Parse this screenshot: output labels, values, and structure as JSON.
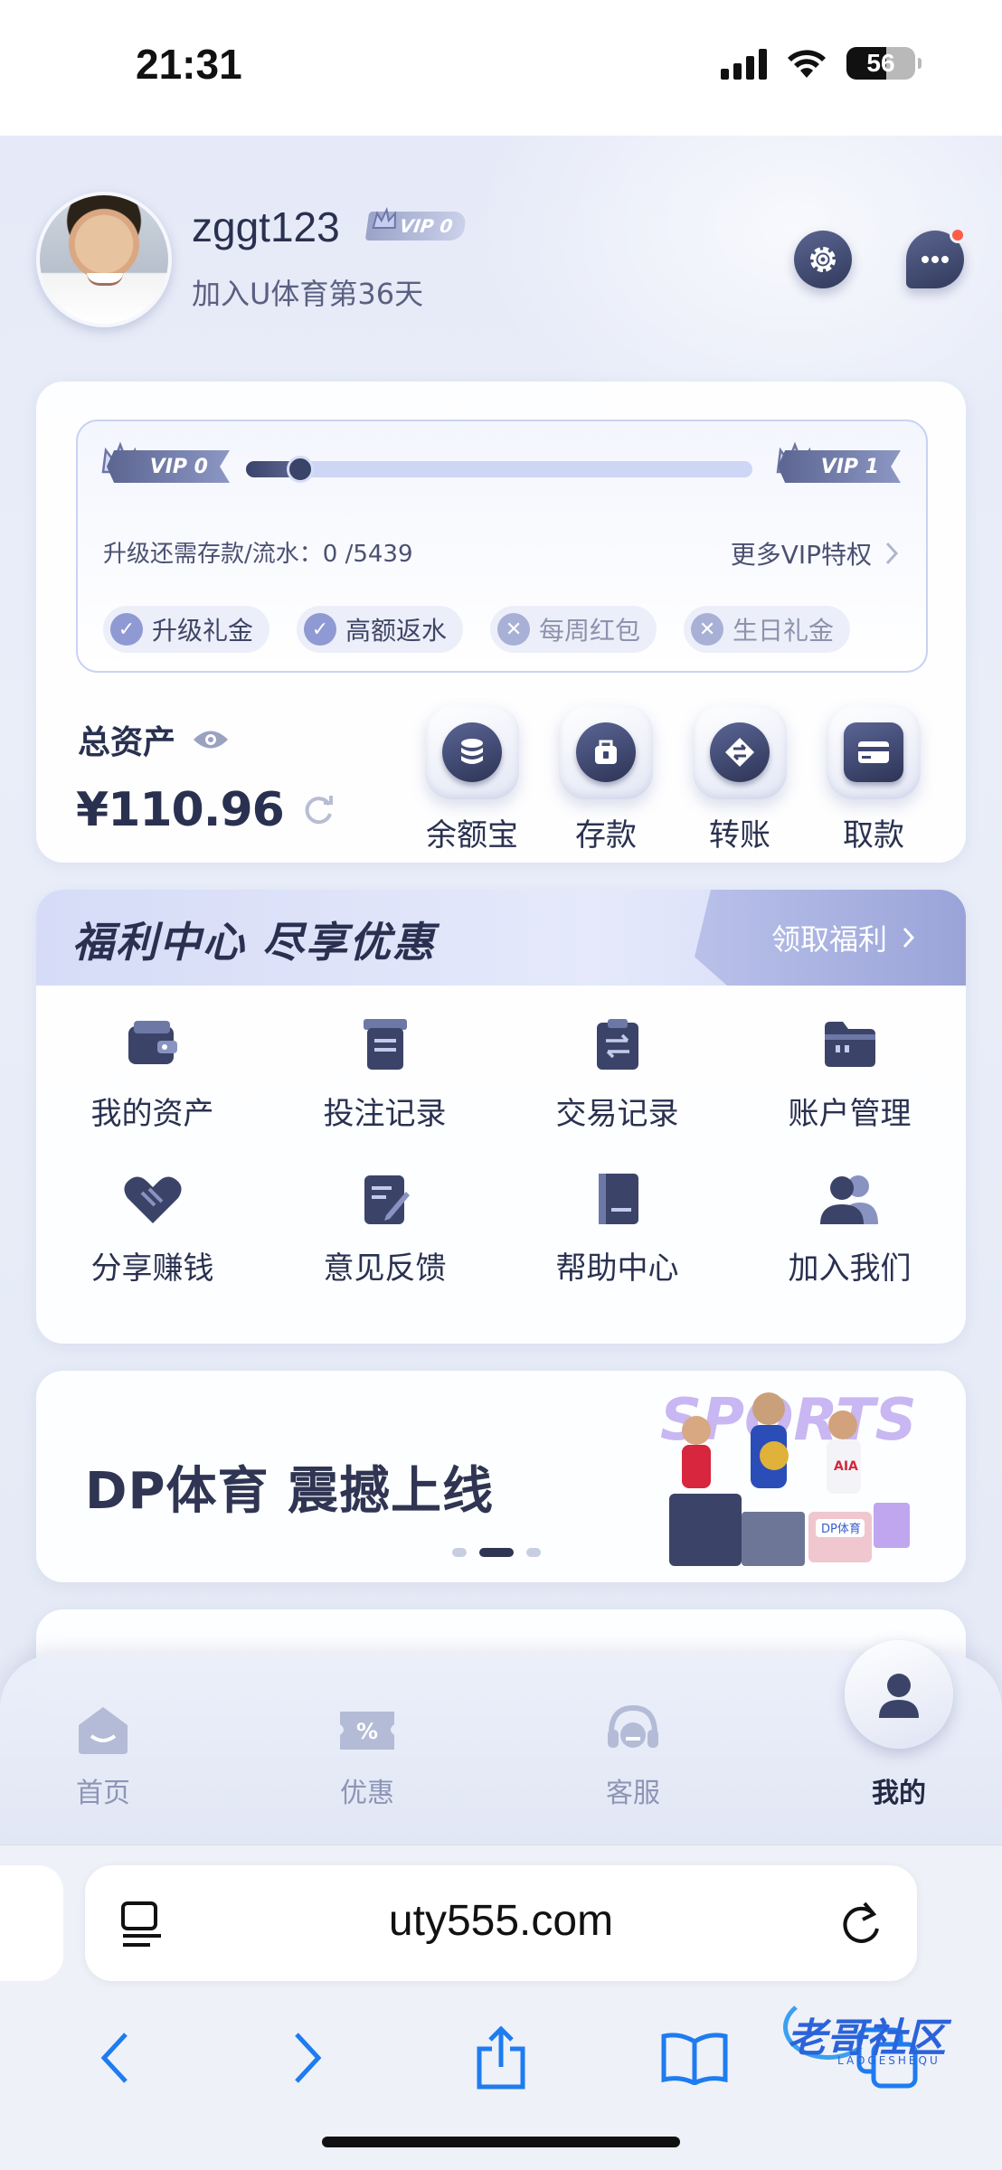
{
  "status_bar": {
    "time": "21:31",
    "battery": "56"
  },
  "profile": {
    "username": "zggt123",
    "vip_level": "VIP 0",
    "join_text": "加入U体育第36天"
  },
  "vip_card": {
    "current_level": "VIP 0",
    "next_level": "VIP 1",
    "progress": 0,
    "upgrade_label": "升级还需存款/流水：",
    "upgrade_value": "0 /5439",
    "more_vip": "更多VIP特权",
    "perks": [
      {
        "label": "升级礼金",
        "enabled": true
      },
      {
        "label": "高额返水",
        "enabled": true
      },
      {
        "label": "每周红包",
        "enabled": false
      },
      {
        "label": "生日礼金",
        "enabled": false
      }
    ]
  },
  "assets": {
    "label": "总资产",
    "currency": "¥",
    "amount": "110.96"
  },
  "actions": [
    {
      "label": "余额宝",
      "icon": "database-icon"
    },
    {
      "label": "存款",
      "icon": "deposit-icon"
    },
    {
      "label": "转账",
      "icon": "transfer-icon"
    },
    {
      "label": "取款",
      "icon": "card-icon"
    }
  ],
  "welfare": {
    "title": "福利中心 尽享优惠",
    "claim_button": "领取福利",
    "items": [
      {
        "label": "我的资产",
        "icon": "wallet-icon"
      },
      {
        "label": "投注记录",
        "icon": "bet-record-icon"
      },
      {
        "label": "交易记录",
        "icon": "transaction-record-icon"
      },
      {
        "label": "账户管理",
        "icon": "folder-icon"
      },
      {
        "label": "分享赚钱",
        "icon": "handshake-icon"
      },
      {
        "label": "意见反馈",
        "icon": "feedback-icon"
      },
      {
        "label": "帮助中心",
        "icon": "help-book-icon"
      },
      {
        "label": "加入我们",
        "icon": "users-icon"
      }
    ]
  },
  "banner": {
    "text": "DP体育 震撼上线",
    "active_slide": 2,
    "slide_count": 3
  },
  "bottom_nav": [
    {
      "label": "首页",
      "icon": "home-icon",
      "active": false
    },
    {
      "label": "优惠",
      "icon": "coupon-icon",
      "active": false
    },
    {
      "label": "客服",
      "icon": "headset-icon",
      "active": false
    },
    {
      "label": "我的",
      "icon": "user-icon",
      "active": true
    }
  ],
  "browser": {
    "url": "uty555.com"
  },
  "watermark": {
    "text": "老哥社区",
    "sub": "LAOGESHEQU"
  },
  "colors": {
    "accent_dark": "#2f3552",
    "accent_light": "#cdd6f5",
    "notification": "#ff5c4a"
  }
}
